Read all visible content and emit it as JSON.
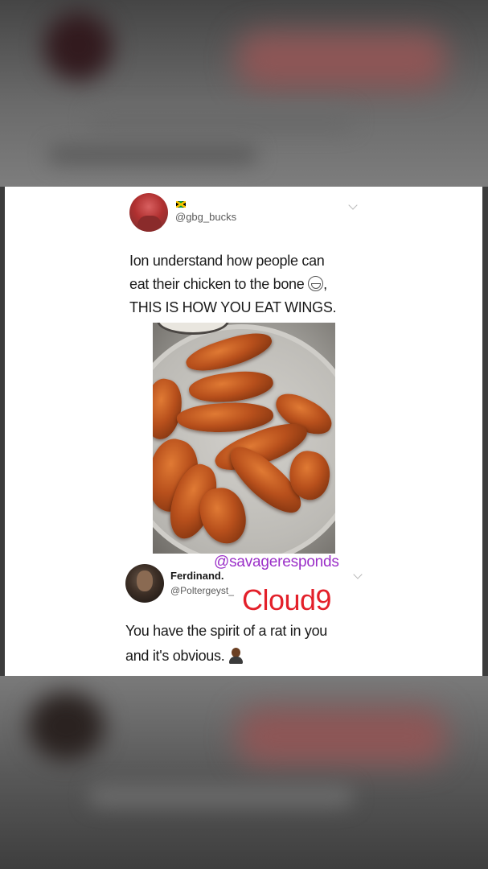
{
  "tweet": {
    "handle": "@gbg_bucks",
    "flag_icon": "jamaica-flag-icon",
    "lines": [
      "Ion understand how people can",
      "eat their chicken to the bone",
      "THIS IS HOW YOU EAT WINGS."
    ],
    "line2_suffix": ",",
    "emoji_icon": "grinning-face-icon",
    "photo_subject": "chicken-wings-plate"
  },
  "reply": {
    "name": "Ferdinand.",
    "handle": "@Poltergeyst_",
    "lines": [
      "You have the spirit of a rat in you",
      "and it's obvious."
    ],
    "emoji_icon": "person-emoji-icon"
  },
  "watermarks": {
    "savage": "@savageresponds",
    "cloud9": "Cloud9"
  },
  "colors": {
    "watermark_purple": "#9b30c8",
    "watermark_red": "#e3202a",
    "card_background": "#ffffff"
  }
}
